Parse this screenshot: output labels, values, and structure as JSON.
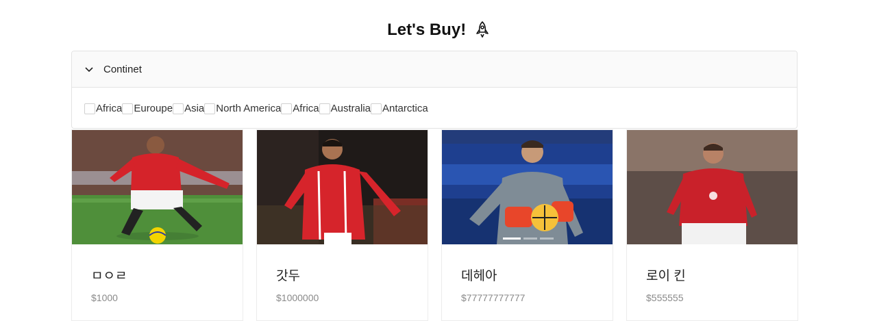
{
  "header": {
    "title": "Let's Buy!",
    "title_icon": "rocket-icon"
  },
  "filter": {
    "panel_label": "Continet",
    "continents": [
      "Africa",
      "Euroupe",
      "Asia",
      "North America",
      "Africa",
      "Australia",
      "Antarctica"
    ]
  },
  "products": [
    {
      "name": "ㅁㅇㄹ",
      "price": "$1000",
      "image_icon": "player-photo"
    },
    {
      "name": "갓두",
      "price": "$1000000",
      "image_icon": "player-photo"
    },
    {
      "name": "데헤아",
      "price": "$77777777777",
      "image_icon": "goalkeeper-photo"
    },
    {
      "name": "로이 킨",
      "price": "$555555",
      "image_icon": "player-photo"
    }
  ],
  "colors": {
    "accent": "#da291c",
    "border": "#e3e3e3",
    "muted_text": "#8a8a8a"
  }
}
